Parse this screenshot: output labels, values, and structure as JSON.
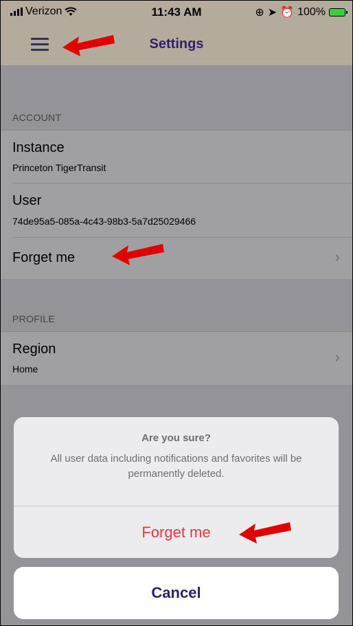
{
  "status_bar": {
    "carrier": "Verizon",
    "time": "11:43 AM",
    "battery": "100%"
  },
  "nav": {
    "title": "Settings",
    "menu_icon": "hamburger-menu-icon"
  },
  "sections": [
    {
      "header": "ACCOUNT",
      "rows": [
        {
          "title": "Instance",
          "subtitle": "Princeton TigerTransit"
        },
        {
          "title": "User",
          "subtitle": "74de95a5-085a-4c43-98b3-5a7d25029466"
        },
        {
          "title": "Forget me",
          "chevron": true
        }
      ]
    },
    {
      "header": "PROFILE",
      "rows": [
        {
          "title": "Region",
          "subtitle": "Home",
          "chevron": true
        }
      ]
    }
  ],
  "action_sheet": {
    "title": "Are you sure?",
    "message": "All user data including notifications and favorites will be permanently deleted.",
    "destructive_label": "Forget me",
    "cancel_label": "Cancel"
  },
  "colors": {
    "accent": "#2f1f6e",
    "destructive": "#e8363e",
    "annotation_arrow": "#e00000"
  }
}
